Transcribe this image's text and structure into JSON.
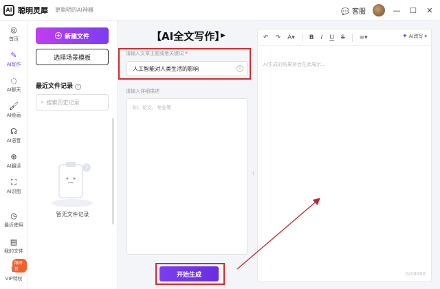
{
  "titlebar": {
    "logo": "AI",
    "app_name": "聪明灵犀",
    "slogan": "更聪明的AI神器",
    "service_label": "客服",
    "minimize": "—",
    "maximize": "☐",
    "close": "✕"
  },
  "sidebar": {
    "items": [
      {
        "label": "首页",
        "icon": "home-icon"
      },
      {
        "label": "AI写作",
        "icon": "pen-icon"
      },
      {
        "label": "AI聊天",
        "icon": "chat-icon"
      },
      {
        "label": "AI绘画",
        "icon": "brush-icon"
      },
      {
        "label": "AI语音",
        "icon": "headset-icon"
      },
      {
        "label": "AI翻译",
        "icon": "translate-icon"
      },
      {
        "label": "AI识图",
        "icon": "scan-icon"
      },
      {
        "label": "最近使用",
        "icon": "clock-icon"
      },
      {
        "label": "我的文件",
        "icon": "file-icon"
      },
      {
        "label": "VIP特权",
        "icon": "crown-icon"
      }
    ],
    "vip_badge": "限时折"
  },
  "filepanel": {
    "new_file": "新建文件",
    "choose_template": "选择场景模板",
    "recent_title": "最近文件记录",
    "search_placeholder": "搜索历史记录",
    "empty_text": "暂无文件记录"
  },
  "main": {
    "heading": "【AI全文写作】",
    "topic_label": "请输入文章主题或者关键词",
    "required_mark": "*",
    "topic_value": "人工智能对人类生活的影响",
    "desc_label": "请输入详细描述",
    "desc_placeholder": "如：论文、专业等",
    "generate_button": "开始生成"
  },
  "editor": {
    "ai_edit": "AI改写",
    "placeholder": "AI生成的结果将会在此展示...",
    "word_count": "0/10000"
  },
  "colors": {
    "accent": "#6a3ee0",
    "highlight_box": "#d32b2b"
  }
}
